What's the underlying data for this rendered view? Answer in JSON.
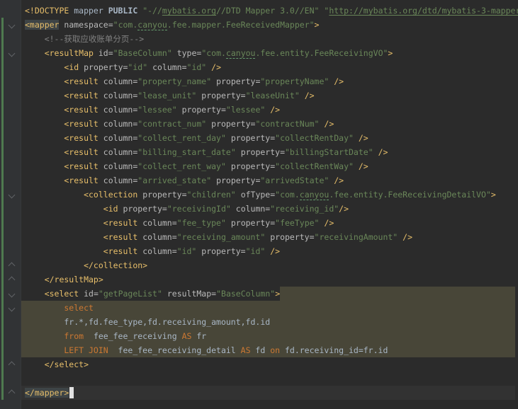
{
  "editor": {
    "palette": {
      "background": "#2b2b2b",
      "gutter_background": "#313335",
      "default_text": "#a9b7c6",
      "xml_tag": "#e8bf6a",
      "xml_attribute": "#bababa",
      "xml_string": "#6a8759",
      "comment": "#808080",
      "sql_keyword": "#cc7832",
      "injected_fragment_background": "#484638",
      "matched_tag_background": "#3e4446",
      "caret_line_background": "#323232",
      "vcs_added_stripe": "#4f7a4f",
      "fold_icon": "#606366",
      "caret": "#e2e2e2"
    },
    "lines": [
      {
        "tokens": [
          [
            "tag",
            "<!DOCTYPE"
          ],
          [
            "plain",
            " mapper "
          ],
          [
            "plainb",
            "PUBLIC"
          ],
          [
            "plain",
            " "
          ],
          [
            "str",
            "\"-//"
          ],
          [
            "link",
            "mybatis.org"
          ],
          [
            "str",
            "//DTD Mapper 3.0//EN\""
          ],
          [
            "plain",
            " "
          ],
          [
            "str",
            "\""
          ],
          [
            "link",
            "http://mybatis.org/dtd/mybatis-3-mapper"
          ]
        ]
      },
      {
        "fold": "start",
        "tokens": [
          [
            "tagm",
            "<mapper"
          ],
          [
            "plain",
            " "
          ],
          [
            "attr",
            "namespace="
          ],
          [
            "str",
            "\"com."
          ],
          [
            "typo",
            "canyou"
          ],
          [
            "str",
            ".fee.mapper.FeeReceivedMapper\""
          ],
          [
            "tag",
            ">"
          ]
        ]
      },
      {
        "tokens": [
          [
            "com",
            "    <!--获取应收账单分页-->"
          ]
        ]
      },
      {
        "fold": "start",
        "tokens": [
          [
            "tag",
            "    <resultMap"
          ],
          [
            "plain",
            " "
          ],
          [
            "attr",
            "id="
          ],
          [
            "str",
            "\"BaseColumn\""
          ],
          [
            "plain",
            " "
          ],
          [
            "attr",
            "type="
          ],
          [
            "str",
            "\"com."
          ],
          [
            "typo",
            "canyou"
          ],
          [
            "str",
            ".fee.entity.FeeReceivingVO\""
          ],
          [
            "tag",
            ">"
          ]
        ]
      },
      {
        "tokens": [
          [
            "tag",
            "        <id"
          ],
          [
            "plain",
            " "
          ],
          [
            "attr",
            "property="
          ],
          [
            "str",
            "\"id\""
          ],
          [
            "plain",
            " "
          ],
          [
            "attr",
            "column="
          ],
          [
            "str",
            "\"id\""
          ],
          [
            "plain",
            " "
          ],
          [
            "tag",
            "/>"
          ]
        ]
      },
      {
        "tokens": [
          [
            "tag",
            "        <result"
          ],
          [
            "plain",
            " "
          ],
          [
            "attr",
            "column="
          ],
          [
            "str",
            "\"property_name\""
          ],
          [
            "plain",
            " "
          ],
          [
            "attr",
            "property="
          ],
          [
            "str",
            "\"propertyName\""
          ],
          [
            "plain",
            " "
          ],
          [
            "tag",
            "/>"
          ]
        ]
      },
      {
        "tokens": [
          [
            "tag",
            "        <result"
          ],
          [
            "plain",
            " "
          ],
          [
            "attr",
            "column="
          ],
          [
            "str",
            "\"lease_unit\""
          ],
          [
            "plain",
            " "
          ],
          [
            "attr",
            "property="
          ],
          [
            "str",
            "\"leaseUnit\""
          ],
          [
            "plain",
            " "
          ],
          [
            "tag",
            "/>"
          ]
        ]
      },
      {
        "tokens": [
          [
            "tag",
            "        <result"
          ],
          [
            "plain",
            " "
          ],
          [
            "attr",
            "column="
          ],
          [
            "str",
            "\"lessee\""
          ],
          [
            "plain",
            " "
          ],
          [
            "attr",
            "property="
          ],
          [
            "str",
            "\"lessee\""
          ],
          [
            "plain",
            " "
          ],
          [
            "tag",
            "/>"
          ]
        ]
      },
      {
        "tokens": [
          [
            "tag",
            "        <result"
          ],
          [
            "plain",
            " "
          ],
          [
            "attr",
            "column="
          ],
          [
            "str",
            "\"contract_num\""
          ],
          [
            "plain",
            " "
          ],
          [
            "attr",
            "property="
          ],
          [
            "str",
            "\"contractNum\""
          ],
          [
            "plain",
            " "
          ],
          [
            "tag",
            "/>"
          ]
        ]
      },
      {
        "tokens": [
          [
            "tag",
            "        <result"
          ],
          [
            "plain",
            " "
          ],
          [
            "attr",
            "column="
          ],
          [
            "str",
            "\"collect_rent_day\""
          ],
          [
            "plain",
            " "
          ],
          [
            "attr",
            "property="
          ],
          [
            "str",
            "\"collectRentDay\""
          ],
          [
            "plain",
            " "
          ],
          [
            "tag",
            "/>"
          ]
        ]
      },
      {
        "tokens": [
          [
            "tag",
            "        <result"
          ],
          [
            "plain",
            " "
          ],
          [
            "attr",
            "column="
          ],
          [
            "str",
            "\"billing_start_date\""
          ],
          [
            "plain",
            " "
          ],
          [
            "attr",
            "property="
          ],
          [
            "str",
            "\"billingStartDate\""
          ],
          [
            "plain",
            " "
          ],
          [
            "tag",
            "/>"
          ]
        ]
      },
      {
        "tokens": [
          [
            "tag",
            "        <result"
          ],
          [
            "plain",
            " "
          ],
          [
            "attr",
            "column="
          ],
          [
            "str",
            "\"collect_rent_way\""
          ],
          [
            "plain",
            " "
          ],
          [
            "attr",
            "property="
          ],
          [
            "str",
            "\"collectRentWay\""
          ],
          [
            "plain",
            " "
          ],
          [
            "tag",
            "/>"
          ]
        ]
      },
      {
        "tokens": [
          [
            "tag",
            "        <result"
          ],
          [
            "plain",
            " "
          ],
          [
            "attr",
            "column="
          ],
          [
            "str",
            "\"arrived_state\""
          ],
          [
            "plain",
            " "
          ],
          [
            "attr",
            "property="
          ],
          [
            "str",
            "\"arrivedState\""
          ],
          [
            "plain",
            " "
          ],
          [
            "tag",
            "/>"
          ]
        ]
      },
      {
        "fold": "start",
        "tokens": [
          [
            "tag",
            "            <collection"
          ],
          [
            "plain",
            " "
          ],
          [
            "attr",
            "property="
          ],
          [
            "str",
            "\"children\""
          ],
          [
            "plain",
            " "
          ],
          [
            "attr",
            "ofType="
          ],
          [
            "str",
            "\"com."
          ],
          [
            "typo",
            "canyou"
          ],
          [
            "str",
            ".fee.entity.FeeReceivingDetailVO\""
          ],
          [
            "tag",
            ">"
          ]
        ]
      },
      {
        "tokens": [
          [
            "tag",
            "                <id"
          ],
          [
            "plain",
            " "
          ],
          [
            "attr",
            "property="
          ],
          [
            "str",
            "\"receivingId\""
          ],
          [
            "plain",
            " "
          ],
          [
            "attr",
            "column="
          ],
          [
            "str",
            "\"receiving_id\""
          ],
          [
            "tag",
            "/>"
          ]
        ]
      },
      {
        "tokens": [
          [
            "tag",
            "                <result"
          ],
          [
            "plain",
            " "
          ],
          [
            "attr",
            "column="
          ],
          [
            "str",
            "\"fee_type\""
          ],
          [
            "plain",
            " "
          ],
          [
            "attr",
            "property="
          ],
          [
            "str",
            "\"feeType\""
          ],
          [
            "plain",
            " "
          ],
          [
            "tag",
            "/>"
          ]
        ]
      },
      {
        "tokens": [
          [
            "tag",
            "                <result"
          ],
          [
            "plain",
            " "
          ],
          [
            "attr",
            "column="
          ],
          [
            "str",
            "\"receiving_amount\""
          ],
          [
            "plain",
            " "
          ],
          [
            "attr",
            "property="
          ],
          [
            "str",
            "\"receivingAmount\""
          ],
          [
            "plain",
            " "
          ],
          [
            "tag",
            "/>"
          ]
        ]
      },
      {
        "tokens": [
          [
            "tag",
            "                <result"
          ],
          [
            "plain",
            " "
          ],
          [
            "attr",
            "column="
          ],
          [
            "str",
            "\"id\""
          ],
          [
            "plain",
            " "
          ],
          [
            "attr",
            "property="
          ],
          [
            "str",
            "\"id\""
          ],
          [
            "plain",
            " "
          ],
          [
            "tag",
            "/>"
          ]
        ]
      },
      {
        "fold": "end",
        "tokens": [
          [
            "tag",
            "            </collection>"
          ]
        ]
      },
      {
        "fold": "end",
        "tokens": [
          [
            "tag",
            "    </resultMap>"
          ]
        ]
      },
      {
        "fold": "start",
        "tail": true,
        "tokens": [
          [
            "tag",
            "    <select"
          ],
          [
            "plain",
            " "
          ],
          [
            "attr",
            "id="
          ],
          [
            "str",
            "\"getPageList\""
          ],
          [
            "plain",
            " "
          ],
          [
            "attr",
            "resultMap="
          ],
          [
            "str",
            "\"BaseColumn\""
          ],
          [
            "tag",
            ">"
          ]
        ]
      },
      {
        "fold": "start",
        "bg": "injected",
        "tokens": [
          [
            "kw",
            "        select"
          ]
        ]
      },
      {
        "bg": "injected",
        "tokens": [
          [
            "plain",
            "        fr.*,fd.fee_type,fd.receiving_amount,fd.id"
          ]
        ]
      },
      {
        "bg": "injected",
        "tokens": [
          [
            "kw",
            "        from"
          ],
          [
            "plain",
            "  fee_fee_receiving "
          ],
          [
            "kw",
            "AS"
          ],
          [
            "plain",
            " fr"
          ]
        ]
      },
      {
        "bg": "injected",
        "tokens": [
          [
            "kw",
            "        LEFT JOIN"
          ],
          [
            "plain",
            "  fee_fee_receiving_detail "
          ],
          [
            "kw",
            "AS"
          ],
          [
            "plain",
            " fd "
          ],
          [
            "kw",
            "on"
          ],
          [
            "plain",
            " fd.receiving_id=fr.id"
          ]
        ]
      },
      {
        "fold": "end",
        "tokens": [
          [
            "tag",
            "    </select>"
          ]
        ]
      },
      {
        "tokens": []
      },
      {
        "fold": "end",
        "bg": "caret",
        "caret": true,
        "tokens": [
          [
            "tagm",
            "</mapper>"
          ]
        ]
      }
    ]
  }
}
